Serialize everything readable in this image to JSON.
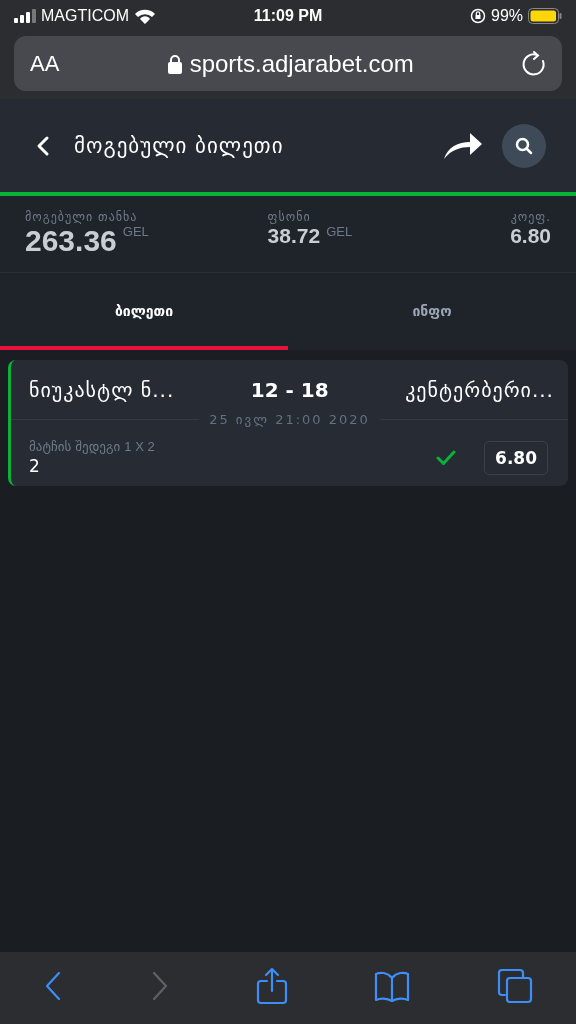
{
  "status_bar": {
    "carrier": "MAGTICOM",
    "time": "11:09 PM",
    "battery": "99%"
  },
  "address_bar": {
    "text_size": "AA",
    "url": "sports.adjarabet.com"
  },
  "header": {
    "title": "მოგებული ბილეთი"
  },
  "summary": [
    {
      "label": "მოგებული თანხა",
      "value": "263.36",
      "currency": "GEL",
      "kind": "large"
    },
    {
      "label": "ფსონი",
      "value": "38.72",
      "currency": "GEL",
      "kind": "normal"
    },
    {
      "label": "კოეფ.",
      "value": "6.80",
      "kind": "right"
    }
  ],
  "tabs": [
    {
      "label": "ბილეთი",
      "selected": true
    },
    {
      "label": "ინფო",
      "selected": false
    }
  ],
  "ticket": {
    "home": "ნიუკასტლ ნ...",
    "score": "12 - 18",
    "away": "კენტერბერი...",
    "date": "25 ივლ 21:00 2020",
    "market": "მატჩის შედეგი",
    "market_type": "1 X 2",
    "pick": "2",
    "won": true,
    "odds": "6.80"
  },
  "toolbar": [
    {
      "kind": "back",
      "disabled": false
    },
    {
      "kind": "forward",
      "disabled": true
    },
    {
      "kind": "share",
      "disabled": false
    },
    {
      "kind": "bookmarks",
      "disabled": false
    },
    {
      "kind": "tabs",
      "disabled": false
    }
  ]
}
